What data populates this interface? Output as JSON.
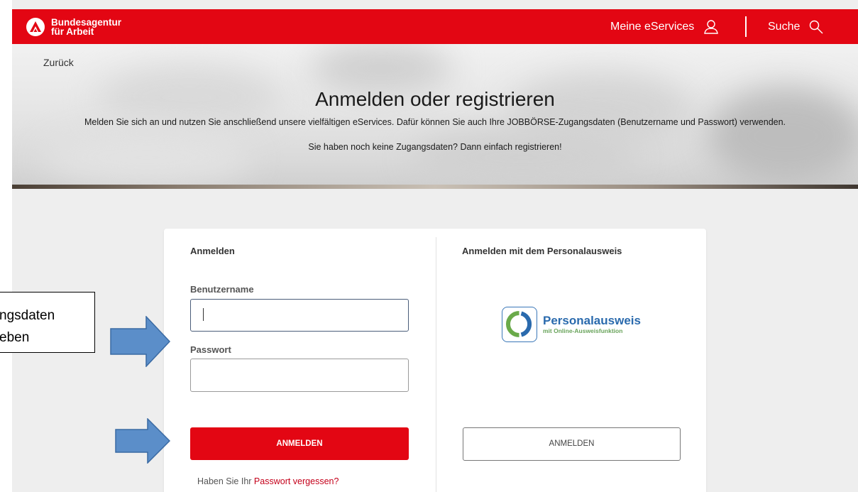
{
  "header": {
    "brand_line1": "Bundesagentur",
    "brand_line2": "für Arbeit",
    "nav_eservices": "Meine eServices",
    "nav_suche": "Suche",
    "brand_color": "#e30613"
  },
  "hero": {
    "back": "Zurück",
    "title": "Anmelden oder registrieren",
    "subtitle": "Melden Sie sich an und nutzen Sie anschließend unsere vielfältigen eServices. Dafür können Sie auch Ihre JOBBÖRSE-Zugangsdaten (Benutzername und Passwort) verwenden.",
    "subtitle2": "Sie haben noch keine Zugangsdaten? Dann einfach registrieren!"
  },
  "login": {
    "title": "Anmelden",
    "username_label": "Benutzername",
    "username_value": "",
    "password_label": "Passwort",
    "password_value": "",
    "submit": "ANMELDEN",
    "forgot_prefix": "Haben Sie Ihr",
    "forgot_link": "Passwort vergessen?"
  },
  "id_login": {
    "title": "Anmelden mit dem Personalausweis",
    "logo_title": "Personalausweis",
    "logo_subtitle": "mit Online-Ausweisfunktion",
    "submit": "ANMELDEN"
  },
  "annotation": {
    "line1": "ngsdaten",
    "line2": "eben"
  },
  "icons": [
    "user-icon",
    "search-icon",
    "personalausweis-logo-icon",
    "arrow-right-icon"
  ]
}
